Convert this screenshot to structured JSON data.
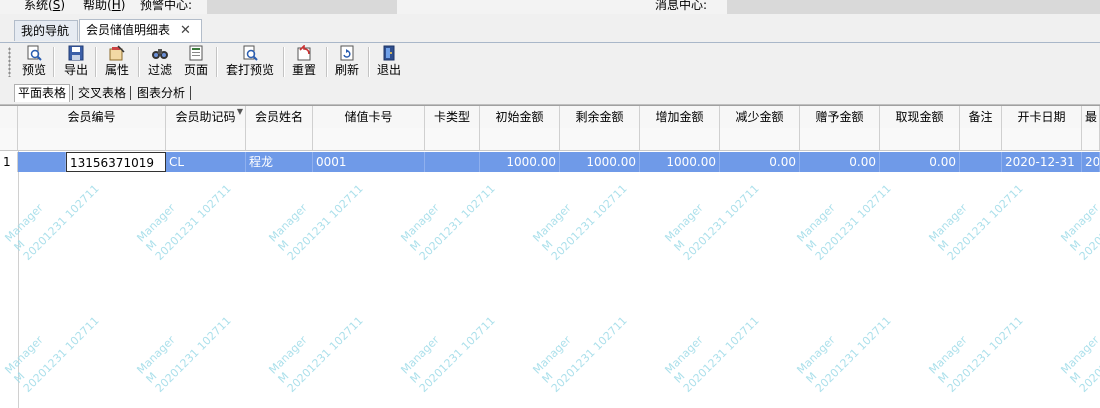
{
  "menu": {
    "system": "系统(S)",
    "system_prefix": "系统(",
    "system_key": "S",
    "help_prefix": "帮助(",
    "help_key": "H",
    "alert_center": "预警中心:",
    "message_center": "消息中心:"
  },
  "doc_tabs": [
    {
      "label": "我的导航"
    },
    {
      "label": "会员储值明细表"
    }
  ],
  "toolbar": [
    {
      "label": "预览",
      "icon": "preview-icon"
    },
    {
      "label": "导出",
      "icon": "export-icon"
    },
    {
      "label": "属性",
      "icon": "properties-icon"
    },
    {
      "label": "过滤",
      "icon": "filter-icon"
    },
    {
      "label": "页面",
      "icon": "page-icon"
    },
    {
      "label": "套打预览",
      "icon": "print-preview-icon"
    },
    {
      "label": "重置",
      "icon": "reset-icon"
    },
    {
      "label": "刷新",
      "icon": "refresh-icon"
    },
    {
      "label": "退出",
      "icon": "exit-icon"
    }
  ],
  "view_tabs": [
    {
      "label": "平面表格"
    },
    {
      "label": "交叉表格"
    },
    {
      "label": "图表分析"
    }
  ],
  "grid": {
    "columns": [
      "会员编号",
      "会员助记码",
      "会员姓名",
      "储值卡号",
      "卡类型",
      "初始金额",
      "剩余金额",
      "增加金额",
      "减少金额",
      "赠予金额",
      "取现金额",
      "备注",
      "开卡日期",
      "最"
    ],
    "rows": [
      {
        "no": "1",
        "cells": [
          "13156371019",
          "CL",
          "程龙",
          "0001",
          "",
          "1000.00",
          "1000.00",
          "1000.00",
          "0.00",
          "0.00",
          "0.00",
          "",
          "2020-12-31",
          "20"
        ]
      }
    ]
  },
  "watermark": {
    "line1": "Manager",
    "line2": "M",
    "line3": "20201231 102711"
  },
  "colors": {
    "selection": "#6f9ae8",
    "watermark": "#9edbe8"
  }
}
